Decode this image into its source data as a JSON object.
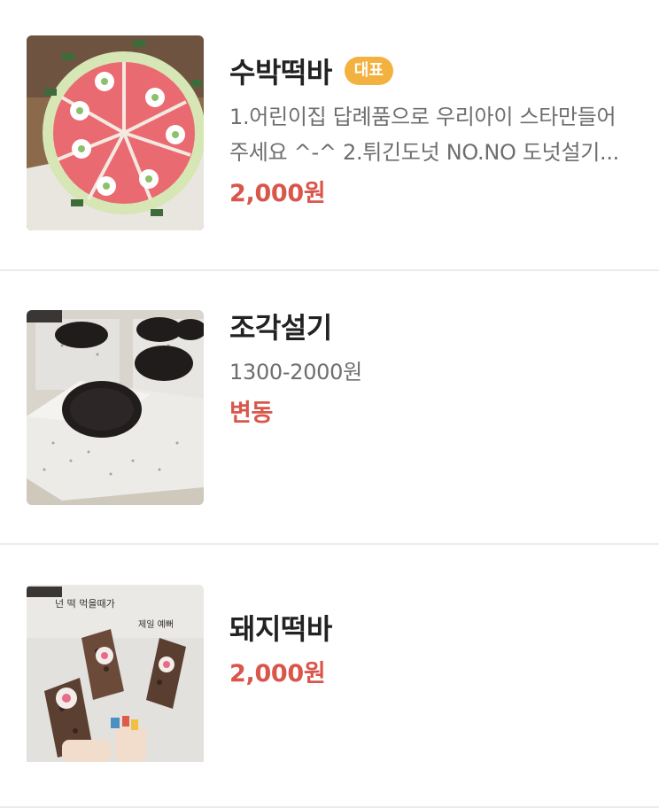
{
  "items": [
    {
      "title": "수박떡바",
      "badge": "대표",
      "description": "1.어린이집 답례품으로 우리아이 스타만들어주세요 ^-^ 2.튀긴도넛 NO.NO 도넛설기...",
      "price": "2,000원",
      "image": "watermelon-rice-cake-photo"
    },
    {
      "title": "조각설기",
      "description": "1300-2000원",
      "price": "변동",
      "image": "oreo-sulgi-photo"
    },
    {
      "title": "돼지떡바",
      "price": "2,000원",
      "image": "pig-rice-cake-bar-photo",
      "image_text": "넌 떡 먹을때가 제일 예뻐"
    }
  ],
  "colors": {
    "badge": "#f3b13f",
    "price": "#d9564b",
    "divider": "#ececec"
  }
}
